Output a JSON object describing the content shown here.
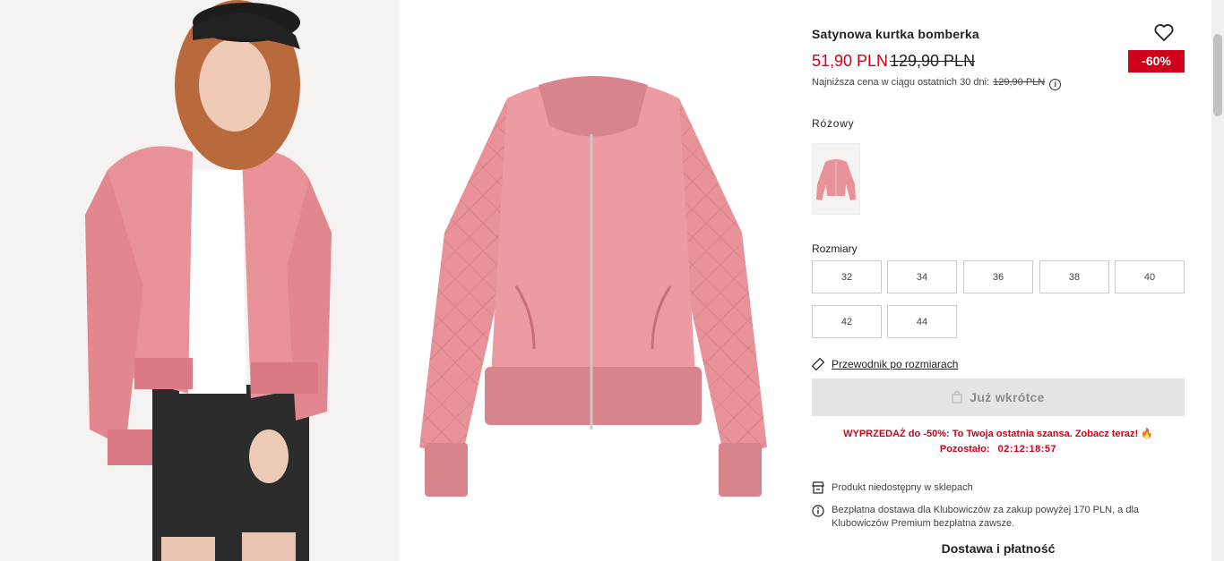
{
  "product": {
    "title": "Satynowa kurtka bomberka",
    "price_new": "51,90 PLN",
    "price_old": "129,90 PLN",
    "discount_badge": "-60%",
    "lowest_price_label": "Najniższa cena w ciągu ostatnich 30 dni:",
    "lowest_price_value": "129,90 PLN",
    "info_icon_glyph": "i",
    "color_name": "Różowy"
  },
  "sizes": {
    "label": "Rozmiary",
    "options": [
      "32",
      "34",
      "36",
      "38",
      "40",
      "42",
      "44"
    ]
  },
  "size_guide": {
    "label": "Przewodnik po rozmiarach",
    "icon": "ruler-icon"
  },
  "cta": {
    "label": "Już wkrótce",
    "icon": "bag-icon"
  },
  "sale": {
    "message": "WYPRZEDAŻ do -50%: To Twoja ostatnia szansa. Zobacz teraz! 🔥",
    "remaining_label": "Pozostało:",
    "timer": "02:12:18:57"
  },
  "store": {
    "text": "Produkt niedostępny w sklepach",
    "icon": "store-icon"
  },
  "delivery": {
    "text": "Bezpłatna dostawa dla Klubowiczów za zakup powyżej 170 PLN, a dla Klubowiczów Premium bezpłatna zawsze.",
    "heading": "Dostawa i płatność",
    "icon": "info-icon"
  },
  "colors": {
    "accent_red": "#d0021b",
    "jacket_pink": "#e8939a",
    "button_disabled_bg": "#e5e5e5"
  }
}
